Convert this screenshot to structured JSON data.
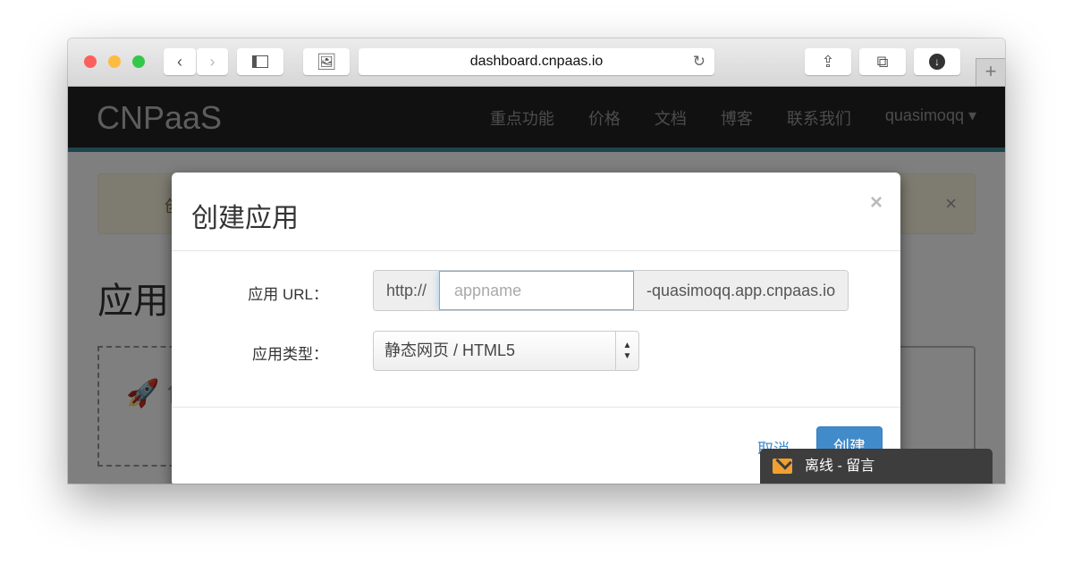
{
  "browser": {
    "url": "dashboard.cnpaas.io",
    "colors": {
      "close": "#fc605c",
      "minimize": "#fdbc40",
      "maximize": "#34c84a"
    }
  },
  "navbar": {
    "brand": "CNPaaS",
    "links": [
      "重点功能",
      "价格",
      "文档",
      "博客",
      "联系我们"
    ],
    "user": "quasimoqq ▾"
  },
  "background": {
    "alert_partial": "创",
    "heading_partial": "应用",
    "card_partial": "创",
    "alert_close": "×"
  },
  "modal": {
    "title": "创建应用",
    "close": "×",
    "url_label": "应用 URL：",
    "url_prefix": "http://",
    "url_placeholder": "appname",
    "url_suffix": "-quasimoqq.app.cnpaas.io",
    "type_label": "应用类型：",
    "type_value": "静态网页 / HTML5",
    "cancel": "取消",
    "create": "创建",
    "accent": "#428bca"
  },
  "chat": {
    "label": "离线 - 留言"
  }
}
